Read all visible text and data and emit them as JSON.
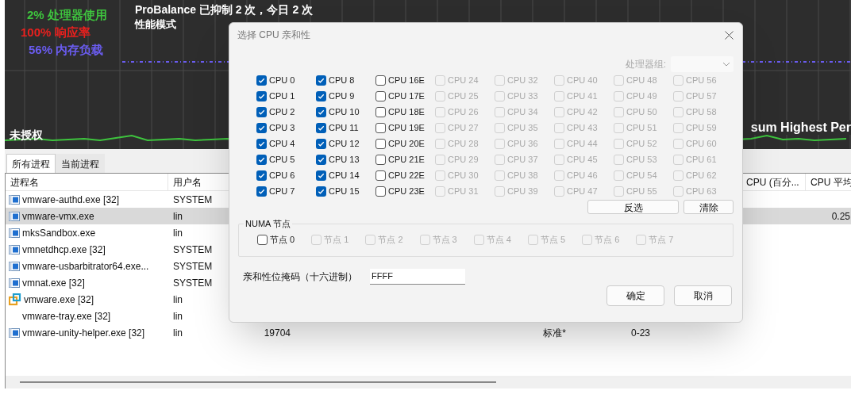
{
  "graph": {
    "stats": [
      {
        "text": "2% 处理器使用",
        "color": "#3ec43e"
      },
      {
        "text": "100% 响应率",
        "color": "#e8201e"
      },
      {
        "text": "56% 内存负载",
        "color": "#6a5cf0"
      }
    ],
    "status": "ProBalance 已抑制 2 次，今日 2 次",
    "mode": "性能模式",
    "license": "未授权",
    "plan": "sum Highest Per"
  },
  "tabs": [
    {
      "label": "所有进程",
      "selected": true
    },
    {
      "label": "当前进程",
      "selected": false
    }
  ],
  "table": {
    "columns": {
      "name": "进程名",
      "user": "用户名",
      "column_9": "CPU (百分...",
      "column_10": "CPU 平均"
    },
    "rows": [
      {
        "kind": "app",
        "name": "vmware-authd.exe [32]",
        "user": "SYSTEM",
        "selected": false
      },
      {
        "kind": "app",
        "name": "vmware-vmx.exe",
        "user": "lin",
        "cpu_avg": "0.25",
        "selected": true
      },
      {
        "kind": "app",
        "name": "mksSandbox.exe",
        "user": "lin",
        "selected": false
      },
      {
        "kind": "app",
        "name": "vmnetdhcp.exe [32]",
        "user": "SYSTEM",
        "selected": false
      },
      {
        "kind": "app",
        "name": "vmware-usbarbitrator64.exe...",
        "user": "SYSTEM",
        "selected": false
      },
      {
        "kind": "app",
        "name": "vmnat.exe [32]",
        "user": "SYSTEM",
        "selected": false
      },
      {
        "kind": "vmware",
        "name": "vmware.exe [32]",
        "user": "lin",
        "selected": false
      },
      {
        "kind": "plain",
        "name": "vmware-tray.exe [32]",
        "user": "lin",
        "selected": false
      },
      {
        "kind": "app",
        "name": "vmware-unity-helper.exe [32]",
        "user": "lin",
        "pid": "19704",
        "priority": "标准*",
        "affinity": "0-23",
        "selected": false
      }
    ]
  },
  "dialog": {
    "title": "选择 CPU 亲和性",
    "group_label": "处理器组:",
    "group_disabled": true,
    "cpus": [
      {
        "label": "CPU 0",
        "checked": true,
        "disabled": false
      },
      {
        "label": "CPU 1",
        "checked": true,
        "disabled": false
      },
      {
        "label": "CPU 2",
        "checked": true,
        "disabled": false
      },
      {
        "label": "CPU 3",
        "checked": true,
        "disabled": false
      },
      {
        "label": "CPU 4",
        "checked": true,
        "disabled": false
      },
      {
        "label": "CPU 5",
        "checked": true,
        "disabled": false
      },
      {
        "label": "CPU 6",
        "checked": true,
        "disabled": false
      },
      {
        "label": "CPU 7",
        "checked": true,
        "disabled": false
      },
      {
        "label": "CPU 8",
        "checked": true,
        "disabled": false
      },
      {
        "label": "CPU 9",
        "checked": true,
        "disabled": false
      },
      {
        "label": "CPU 10",
        "checked": true,
        "disabled": false
      },
      {
        "label": "CPU 11",
        "checked": true,
        "disabled": false
      },
      {
        "label": "CPU 12",
        "checked": true,
        "disabled": false
      },
      {
        "label": "CPU 13",
        "checked": true,
        "disabled": false
      },
      {
        "label": "CPU 14",
        "checked": true,
        "disabled": false
      },
      {
        "label": "CPU 15",
        "checked": true,
        "disabled": false
      },
      {
        "label": "CPU 16E",
        "checked": false,
        "disabled": false
      },
      {
        "label": "CPU 17E",
        "checked": false,
        "disabled": false
      },
      {
        "label": "CPU 18E",
        "checked": false,
        "disabled": false
      },
      {
        "label": "CPU 19E",
        "checked": false,
        "disabled": false
      },
      {
        "label": "CPU 20E",
        "checked": false,
        "disabled": false
      },
      {
        "label": "CPU 21E",
        "checked": false,
        "disabled": false
      },
      {
        "label": "CPU 22E",
        "checked": false,
        "disabled": false
      },
      {
        "label": "CPU 23E",
        "checked": false,
        "disabled": false
      },
      {
        "label": "CPU 24",
        "checked": false,
        "disabled": true
      },
      {
        "label": "CPU 25",
        "checked": false,
        "disabled": true
      },
      {
        "label": "CPU 26",
        "checked": false,
        "disabled": true
      },
      {
        "label": "CPU 27",
        "checked": false,
        "disabled": true
      },
      {
        "label": "CPU 28",
        "checked": false,
        "disabled": true
      },
      {
        "label": "CPU 29",
        "checked": false,
        "disabled": true
      },
      {
        "label": "CPU 30",
        "checked": false,
        "disabled": true
      },
      {
        "label": "CPU 31",
        "checked": false,
        "disabled": true
      },
      {
        "label": "CPU 32",
        "checked": false,
        "disabled": true
      },
      {
        "label": "CPU 33",
        "checked": false,
        "disabled": true
      },
      {
        "label": "CPU 34",
        "checked": false,
        "disabled": true
      },
      {
        "label": "CPU 35",
        "checked": false,
        "disabled": true
      },
      {
        "label": "CPU 36",
        "checked": false,
        "disabled": true
      },
      {
        "label": "CPU 37",
        "checked": false,
        "disabled": true
      },
      {
        "label": "CPU 38",
        "checked": false,
        "disabled": true
      },
      {
        "label": "CPU 39",
        "checked": false,
        "disabled": true
      },
      {
        "label": "CPU 40",
        "checked": false,
        "disabled": true
      },
      {
        "label": "CPU 41",
        "checked": false,
        "disabled": true
      },
      {
        "label": "CPU 42",
        "checked": false,
        "disabled": true
      },
      {
        "label": "CPU 43",
        "checked": false,
        "disabled": true
      },
      {
        "label": "CPU 44",
        "checked": false,
        "disabled": true
      },
      {
        "label": "CPU 45",
        "checked": false,
        "disabled": true
      },
      {
        "label": "CPU 46",
        "checked": false,
        "disabled": true
      },
      {
        "label": "CPU 47",
        "checked": false,
        "disabled": true
      },
      {
        "label": "CPU 48",
        "checked": false,
        "disabled": true
      },
      {
        "label": "CPU 49",
        "checked": false,
        "disabled": true
      },
      {
        "label": "CPU 50",
        "checked": false,
        "disabled": true
      },
      {
        "label": "CPU 51",
        "checked": false,
        "disabled": true
      },
      {
        "label": "CPU 52",
        "checked": false,
        "disabled": true
      },
      {
        "label": "CPU 53",
        "checked": false,
        "disabled": true
      },
      {
        "label": "CPU 54",
        "checked": false,
        "disabled": true
      },
      {
        "label": "CPU 55",
        "checked": false,
        "disabled": true
      },
      {
        "label": "CPU 56",
        "checked": false,
        "disabled": true
      },
      {
        "label": "CPU 57",
        "checked": false,
        "disabled": true
      },
      {
        "label": "CPU 58",
        "checked": false,
        "disabled": true
      },
      {
        "label": "CPU 59",
        "checked": false,
        "disabled": true
      },
      {
        "label": "CPU 60",
        "checked": false,
        "disabled": true
      },
      {
        "label": "CPU 61",
        "checked": false,
        "disabled": true
      },
      {
        "label": "CPU 62",
        "checked": false,
        "disabled": true
      },
      {
        "label": "CPU 63",
        "checked": false,
        "disabled": true
      }
    ],
    "select_buttons": [
      "反选",
      "清除"
    ],
    "numa": {
      "title": "NUMA 节点",
      "nodes": [
        {
          "label": "节点 0",
          "checked": false,
          "disabled": false
        },
        {
          "label": "节点 1",
          "checked": false,
          "disabled": true
        },
        {
          "label": "节点 2",
          "checked": false,
          "disabled": true
        },
        {
          "label": "节点 3",
          "checked": false,
          "disabled": true
        },
        {
          "label": "节点 4",
          "checked": false,
          "disabled": true
        },
        {
          "label": "节点 5",
          "checked": false,
          "disabled": true
        },
        {
          "label": "节点 6",
          "checked": false,
          "disabled": true
        },
        {
          "label": "节点 7",
          "checked": false,
          "disabled": true
        }
      ]
    },
    "mask": {
      "label": "亲和性位掩码（十六进制）",
      "value": "FFFF"
    },
    "actions": [
      "确定",
      "取消"
    ]
  }
}
